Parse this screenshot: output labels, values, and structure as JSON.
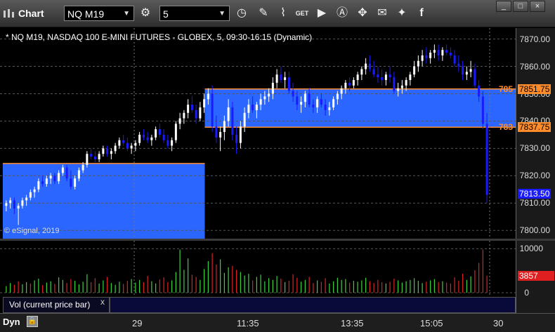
{
  "toolbar": {
    "title": "Chart",
    "symbol": "NQ M19",
    "interval": "5",
    "icons": [
      "gear-icon",
      "clock-icon",
      "pencil-icon",
      "study-icon",
      "get-icon",
      "play-icon",
      "alert-icon",
      "link-icon",
      "comment-icon",
      "twitter-icon",
      "facebook-icon"
    ]
  },
  "window_buttons": [
    "_",
    "□",
    "×"
  ],
  "chart": {
    "caption": "* NQ M19, NASDAQ 100 E-MINI FUTURES - GLOBEX, 5, 09:30-16:15 (Dynamic)",
    "copyright": "© eSignal, 2019",
    "price_axis_labels": [
      "7870.00",
      "7860.00",
      "7850.00",
      "7840.00",
      "7830.00",
      "7820.00",
      "7810.00",
      "7800.00"
    ],
    "price_tags": {
      "upper_level_clipped": "785",
      "upper_level": "7851.75",
      "lower_level_clipped": "783",
      "lower_level": "7837.75",
      "last_price": "7813.50"
    },
    "volume_axis_labels": [
      "10000",
      "0"
    ],
    "volume_tag": "3857",
    "volume_study_label": "Vol (current price bar)",
    "volume_study_close": "x",
    "x_axis_labels": [
      "29",
      "11:35",
      "13:35",
      "15:05",
      "30"
    ],
    "bottom_label": "Dyn"
  },
  "chart_data": {
    "type": "bar",
    "title": "* NQ M19, NASDAQ 100 E-MINI FUTURES - GLOBEX, 5, 09:30-16:15 (Dynamic)",
    "ylim": [
      7797,
      7874
    ],
    "zones": [
      {
        "from_bar": 0,
        "to_bar": 50,
        "low": 7797,
        "high": 7824.5
      },
      {
        "from_bar": 50,
        "to_bar": 184,
        "low": 7837.75,
        "high": 7851.75
      }
    ],
    "colors": {
      "up": "#ffffff",
      "down": "#1a1aff",
      "zone": "#2a66ff",
      "level_line": "#ff8c2a",
      "vol_up": "#3cd23c",
      "vol_down": "#e02020"
    },
    "ohlc": [
      [
        7809,
        7811,
        7807,
        7810
      ],
      [
        7810,
        7812,
        7808,
        7811
      ],
      [
        7811,
        7812,
        7806,
        7808
      ],
      [
        7808,
        7810,
        7802,
        7809
      ],
      [
        7809,
        7812,
        7808,
        7811
      ],
      [
        7811,
        7813,
        7809,
        7812
      ],
      [
        7812,
        7815,
        7811,
        7814
      ],
      [
        7814,
        7816,
        7812,
        7815
      ],
      [
        7815,
        7819,
        7814,
        7818
      ],
      [
        7818,
        7820,
        7816,
        7817
      ],
      [
        7817,
        7820,
        7816,
        7819
      ],
      [
        7819,
        7821,
        7817,
        7820
      ],
      [
        7820,
        7821,
        7817,
        7818
      ],
      [
        7818,
        7822,
        7817,
        7821
      ],
      [
        7821,
        7824,
        7820,
        7823
      ],
      [
        7823,
        7824,
        7818,
        7819
      ],
      [
        7819,
        7822,
        7815,
        7816
      ],
      [
        7816,
        7820,
        7815,
        7819
      ],
      [
        7819,
        7823,
        7818,
        7822
      ],
      [
        7822,
        7825,
        7821,
        7824
      ],
      [
        7824,
        7829,
        7823,
        7828
      ],
      [
        7828,
        7830,
        7826,
        7827
      ],
      [
        7827,
        7829,
        7825,
        7826
      ],
      [
        7826,
        7829,
        7825,
        7828
      ],
      [
        7828,
        7831,
        7827,
        7830
      ],
      [
        7830,
        7831,
        7827,
        7828
      ],
      [
        7828,
        7830,
        7826,
        7829
      ],
      [
        7829,
        7832,
        7828,
        7831
      ],
      [
        7831,
        7834,
        7830,
        7833
      ],
      [
        7833,
        7835,
        7831,
        7832
      ],
      [
        7832,
        7834,
        7829,
        7830
      ],
      [
        7830,
        7832,
        7828,
        7831
      ],
      [
        7831,
        7833,
        7829,
        7832
      ],
      [
        7832,
        7836,
        7831,
        7835
      ],
      [
        7835,
        7837,
        7833,
        7834
      ],
      [
        7834,
        7836,
        7832,
        7833
      ],
      [
        7833,
        7835,
        7831,
        7834
      ],
      [
        7834,
        7838,
        7833,
        7837
      ],
      [
        7837,
        7839,
        7834,
        7835
      ],
      [
        7835,
        7837,
        7832,
        7833
      ],
      [
        7833,
        7835,
        7830,
        7831
      ],
      [
        7831,
        7834,
        7829,
        7833
      ],
      [
        7833,
        7840,
        7832,
        7839
      ],
      [
        7839,
        7843,
        7837,
        7841
      ],
      [
        7841,
        7844,
        7839,
        7843
      ],
      [
        7843,
        7848,
        7841,
        7846
      ],
      [
        7846,
        7849,
        7843,
        7844
      ],
      [
        7844,
        7846,
        7839,
        7841
      ],
      [
        7841,
        7847,
        7840,
        7845
      ],
      [
        7845,
        7850,
        7843,
        7848
      ],
      [
        7848,
        7852,
        7846,
        7850
      ],
      [
        7850,
        7853,
        7836,
        7838
      ],
      [
        7838,
        7842,
        7832,
        7834
      ],
      [
        7834,
        7838,
        7829,
        7836
      ],
      [
        7836,
        7842,
        7833,
        7840
      ],
      [
        7840,
        7848,
        7838,
        7845
      ],
      [
        7845,
        7847,
        7833,
        7835
      ],
      [
        7835,
        7838,
        7828,
        7832
      ],
      [
        7832,
        7840,
        7830,
        7838
      ],
      [
        7838,
        7845,
        7836,
        7843
      ],
      [
        7843,
        7848,
        7841,
        7846
      ],
      [
        7846,
        7849,
        7843,
        7844
      ],
      [
        7844,
        7847,
        7841,
        7846
      ],
      [
        7846,
        7850,
        7844,
        7848
      ],
      [
        7848,
        7851,
        7846,
        7849
      ],
      [
        7849,
        7852,
        7847,
        7850
      ],
      [
        7850,
        7856,
        7848,
        7854
      ],
      [
        7854,
        7859,
        7852,
        7857
      ],
      [
        7857,
        7860,
        7854,
        7855
      ],
      [
        7855,
        7858,
        7852,
        7856
      ],
      [
        7856,
        7858,
        7850,
        7851
      ],
      [
        7851,
        7854,
        7847,
        7849
      ],
      [
        7849,
        7851,
        7844,
        7846
      ],
      [
        7846,
        7849,
        7843,
        7847
      ],
      [
        7847,
        7851,
        7845,
        7850
      ],
      [
        7850,
        7852,
        7845,
        7846
      ],
      [
        7846,
        7848,
        7843,
        7845
      ],
      [
        7845,
        7849,
        7843,
        7848
      ],
      [
        7848,
        7850,
        7845,
        7846
      ],
      [
        7846,
        7848,
        7842,
        7844
      ],
      [
        7844,
        7847,
        7842,
        7845
      ],
      [
        7845,
        7849,
        7844,
        7848
      ],
      [
        7848,
        7851,
        7846,
        7850
      ],
      [
        7850,
        7853,
        7848,
        7852
      ],
      [
        7852,
        7855,
        7850,
        7854
      ],
      [
        7854,
        7856,
        7851,
        7853
      ],
      [
        7853,
        7856,
        7852,
        7855
      ],
      [
        7855,
        7858,
        7853,
        7857
      ],
      [
        7857,
        7860,
        7855,
        7859
      ],
      [
        7859,
        7863,
        7857,
        7861
      ],
      [
        7861,
        7864,
        7858,
        7859
      ],
      [
        7859,
        7862,
        7856,
        7857
      ],
      [
        7857,
        7860,
        7854,
        7856
      ],
      [
        7856,
        7859,
        7853,
        7855
      ],
      [
        7855,
        7858,
        7853,
        7857
      ],
      [
        7857,
        7860,
        7854,
        7856
      ],
      [
        7856,
        7858,
        7850,
        7851
      ],
      [
        7851,
        7854,
        7849,
        7852
      ],
      [
        7852,
        7855,
        7850,
        7853
      ],
      [
        7853,
        7856,
        7851,
        7855
      ],
      [
        7855,
        7858,
        7853,
        7857
      ],
      [
        7857,
        7862,
        7856,
        7860
      ],
      [
        7860,
        7864,
        7858,
        7862
      ],
      [
        7862,
        7866,
        7860,
        7864
      ],
      [
        7864,
        7867,
        7861,
        7863
      ],
      [
        7863,
        7866,
        7861,
        7865
      ],
      [
        7865,
        7868,
        7863,
        7866
      ],
      [
        7866,
        7868,
        7862,
        7864
      ],
      [
        7864,
        7867,
        7862,
        7866
      ],
      [
        7866,
        7868,
        7864,
        7865
      ],
      [
        7865,
        7867,
        7863,
        7864
      ],
      [
        7864,
        7866,
        7860,
        7861
      ],
      [
        7861,
        7864,
        7858,
        7860
      ],
      [
        7860,
        7862,
        7855,
        7857
      ],
      [
        7857,
        7860,
        7855,
        7858
      ],
      [
        7858,
        7862,
        7856,
        7859
      ],
      [
        7859,
        7861,
        7852,
        7853
      ],
      [
        7853,
        7855,
        7847,
        7849
      ],
      [
        7849,
        7851,
        7837,
        7839
      ],
      [
        7839,
        7843,
        7810,
        7813
      ]
    ],
    "volume": [
      [
        1500,
        1
      ],
      [
        2200,
        1
      ],
      [
        1800,
        0
      ],
      [
        2600,
        0
      ],
      [
        1900,
        1
      ],
      [
        2400,
        1
      ],
      [
        2100,
        0
      ],
      [
        2800,
        1
      ],
      [
        3200,
        1
      ],
      [
        1700,
        0
      ],
      [
        2300,
        1
      ],
      [
        2600,
        1
      ],
      [
        2000,
        0
      ],
      [
        3500,
        1
      ],
      [
        2900,
        1
      ],
      [
        2200,
        0
      ],
      [
        3100,
        0
      ],
      [
        2700,
        1
      ],
      [
        1900,
        1
      ],
      [
        2500,
        1
      ],
      [
        4200,
        1
      ],
      [
        2400,
        0
      ],
      [
        3300,
        0
      ],
      [
        2100,
        1
      ],
      [
        2800,
        1
      ],
      [
        3600,
        0
      ],
      [
        2200,
        1
      ],
      [
        1800,
        1
      ],
      [
        2500,
        1
      ],
      [
        2000,
        0
      ],
      [
        2700,
        0
      ],
      [
        3100,
        1
      ],
      [
        2300,
        1
      ],
      [
        2900,
        1
      ],
      [
        2400,
        0
      ],
      [
        3800,
        0
      ],
      [
        2600,
        1
      ],
      [
        2100,
        1
      ],
      [
        3000,
        0
      ],
      [
        3500,
        0
      ],
      [
        2400,
        0
      ],
      [
        2800,
        1
      ],
      [
        4700,
        1
      ],
      [
        9800,
        1
      ],
      [
        5200,
        1
      ],
      [
        7800,
        1
      ],
      [
        4100,
        0
      ],
      [
        3600,
        0
      ],
      [
        2900,
        1
      ],
      [
        5400,
        1
      ],
      [
        7200,
        1
      ],
      [
        9000,
        0
      ],
      [
        6400,
        0
      ],
      [
        7600,
        1
      ],
      [
        4500,
        1
      ],
      [
        5800,
        1
      ],
      [
        6100,
        0
      ],
      [
        5200,
        0
      ],
      [
        4700,
        1
      ],
      [
        3900,
        1
      ],
      [
        4300,
        1
      ],
      [
        2800,
        0
      ],
      [
        3600,
        1
      ],
      [
        4100,
        1
      ],
      [
        2600,
        1
      ],
      [
        3300,
        1
      ],
      [
        2900,
        1
      ],
      [
        3800,
        1
      ],
      [
        3200,
        0
      ],
      [
        2400,
        1
      ],
      [
        2700,
        0
      ],
      [
        4200,
        0
      ],
      [
        3400,
        0
      ],
      [
        2500,
        1
      ],
      [
        2900,
        1
      ],
      [
        3600,
        0
      ],
      [
        2200,
        0
      ],
      [
        2800,
        1
      ],
      [
        2500,
        0
      ],
      [
        3300,
        0
      ],
      [
        2100,
        1
      ],
      [
        2600,
        1
      ],
      [
        3400,
        1
      ],
      [
        2900,
        1
      ],
      [
        3100,
        1
      ],
      [
        2300,
        0
      ],
      [
        2700,
        1
      ],
      [
        2500,
        1
      ],
      [
        2800,
        1
      ],
      [
        3400,
        1
      ],
      [
        2600,
        0
      ],
      [
        2200,
        0
      ],
      [
        2900,
        0
      ],
      [
        2400,
        0
      ],
      [
        2100,
        1
      ],
      [
        2500,
        0
      ],
      [
        3200,
        0
      ],
      [
        2800,
        1
      ],
      [
        2300,
        1
      ],
      [
        2600,
        1
      ],
      [
        2900,
        1
      ],
      [
        3300,
        1
      ],
      [
        2700,
        1
      ],
      [
        2200,
        1
      ],
      [
        2500,
        0
      ],
      [
        2800,
        1
      ],
      [
        3100,
        1
      ],
      [
        2400,
        0
      ],
      [
        2600,
        1
      ],
      [
        2300,
        0
      ],
      [
        2100,
        0
      ],
      [
        3500,
        0
      ],
      [
        2700,
        0
      ],
      [
        4300,
        0
      ],
      [
        2900,
        1
      ],
      [
        3700,
        1
      ],
      [
        5100,
        0
      ],
      [
        6800,
        0
      ],
      [
        9800,
        0
      ],
      [
        3857,
        0
      ]
    ]
  }
}
